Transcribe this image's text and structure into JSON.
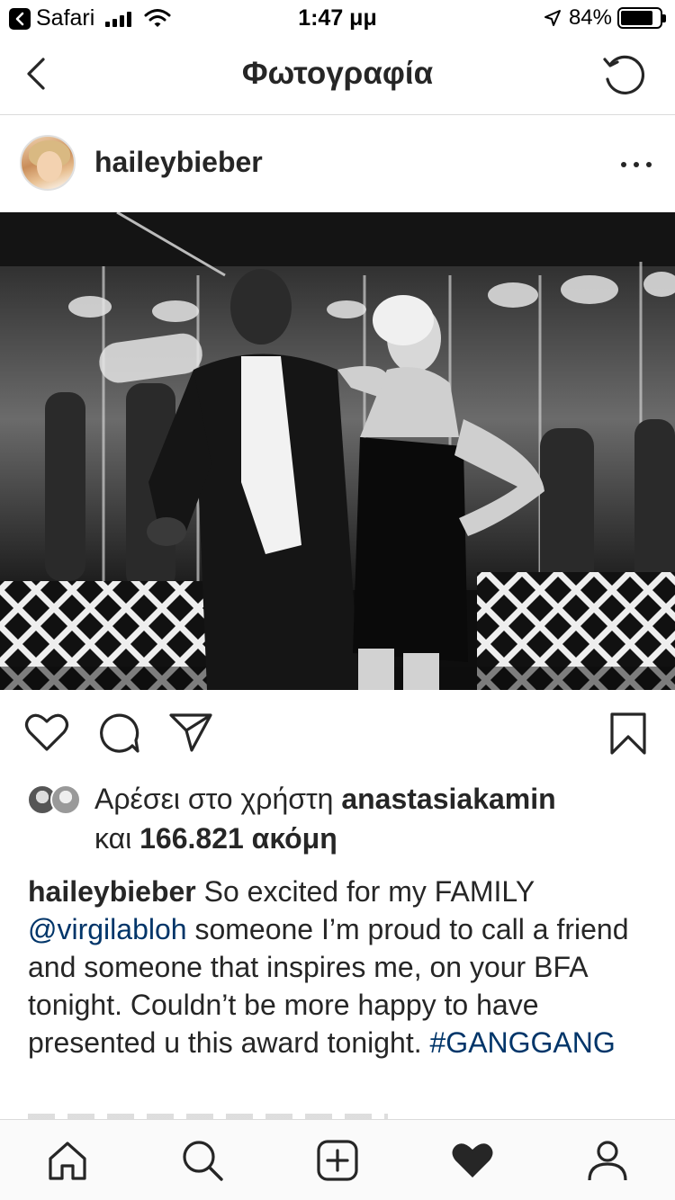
{
  "status_bar": {
    "back_app_label": "Safari",
    "time": "1:47 μμ",
    "battery_percent_text": "84%",
    "battery_level": 0.84,
    "signal_bars": 4
  },
  "nav": {
    "title": "Φωτογραφία",
    "back_icon": "chevron-left-icon",
    "refresh_icon": "refresh-icon"
  },
  "post": {
    "username": "haileybieber",
    "more_icon": "more-horizontal-icon"
  },
  "actions": {
    "like_icon": "heart-outline-icon",
    "comment_icon": "comment-icon",
    "share_icon": "send-icon",
    "save_icon": "bookmark-icon"
  },
  "likes": {
    "prefix": "Αρέσει στο χρήστη",
    "user": "anastasiakamin",
    "and": "και",
    "count": "166.821 ακόμη"
  },
  "caption": {
    "username": "haileybieber",
    "text_before_mention": "So excited for my FAMILY",
    "mention": "@virgilabloh",
    "text_after_mention": "someone I’m proud to call a friend and someone that inspires me, on your BFA tonight. Couldn’t be more happy to have presented u this award tonight.",
    "hashtag": "#GANGGANG"
  },
  "tab_bar": {
    "items": [
      "home-icon",
      "search-icon",
      "add-post-icon",
      "activity-heart-icon",
      "profile-icon"
    ],
    "active_index": 3
  },
  "colors": {
    "text": "#262626",
    "link": "#003569",
    "divider": "#dbdbdb"
  }
}
